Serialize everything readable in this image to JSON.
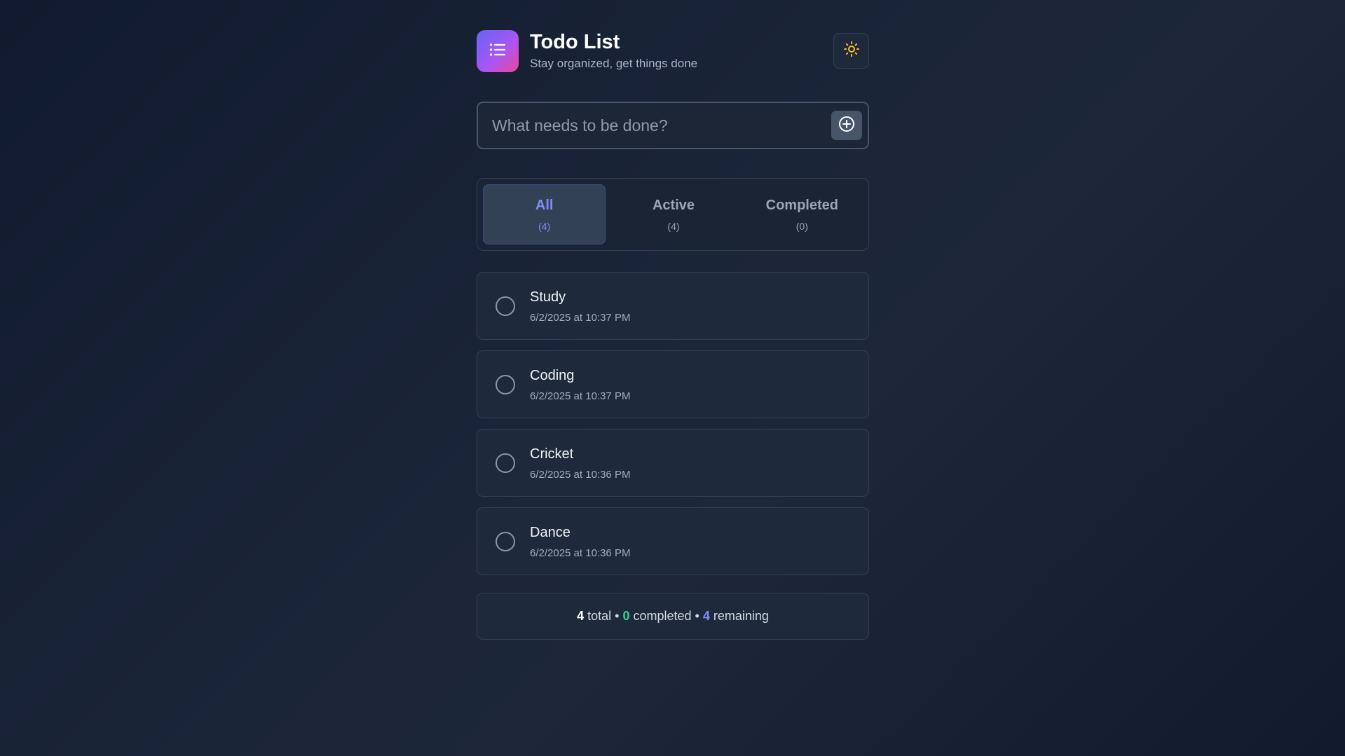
{
  "header": {
    "title": "Todo List",
    "subtitle": "Stay organized, get things done",
    "logo_icon": "list-icon",
    "theme_icon": "sun-icon"
  },
  "input": {
    "placeholder": "What needs to be done?",
    "value": "",
    "add_icon": "plus-circle-icon"
  },
  "tabs": [
    {
      "label": "All",
      "count": "(4)",
      "selected": true
    },
    {
      "label": "Active",
      "count": "(4)",
      "selected": false
    },
    {
      "label": "Completed",
      "count": "(0)",
      "selected": false
    }
  ],
  "todos": [
    {
      "text": "Study",
      "date": "6/2/2025 at 10:37 PM",
      "completed": false
    },
    {
      "text": "Coding",
      "date": "6/2/2025 at 10:37 PM",
      "completed": false
    },
    {
      "text": "Cricket",
      "date": "6/2/2025 at 10:36 PM",
      "completed": false
    },
    {
      "text": "Dance",
      "date": "6/2/2025 at 10:36 PM",
      "completed": false
    }
  ],
  "stats": {
    "total": "4",
    "total_label": "total",
    "separator": "•",
    "completed": "0",
    "completed_label": "completed",
    "remaining": "4",
    "remaining_label": "remaining"
  },
  "colors": {
    "accent": "#818cf8",
    "success": "#34d399",
    "sun": "#fbbf24"
  }
}
